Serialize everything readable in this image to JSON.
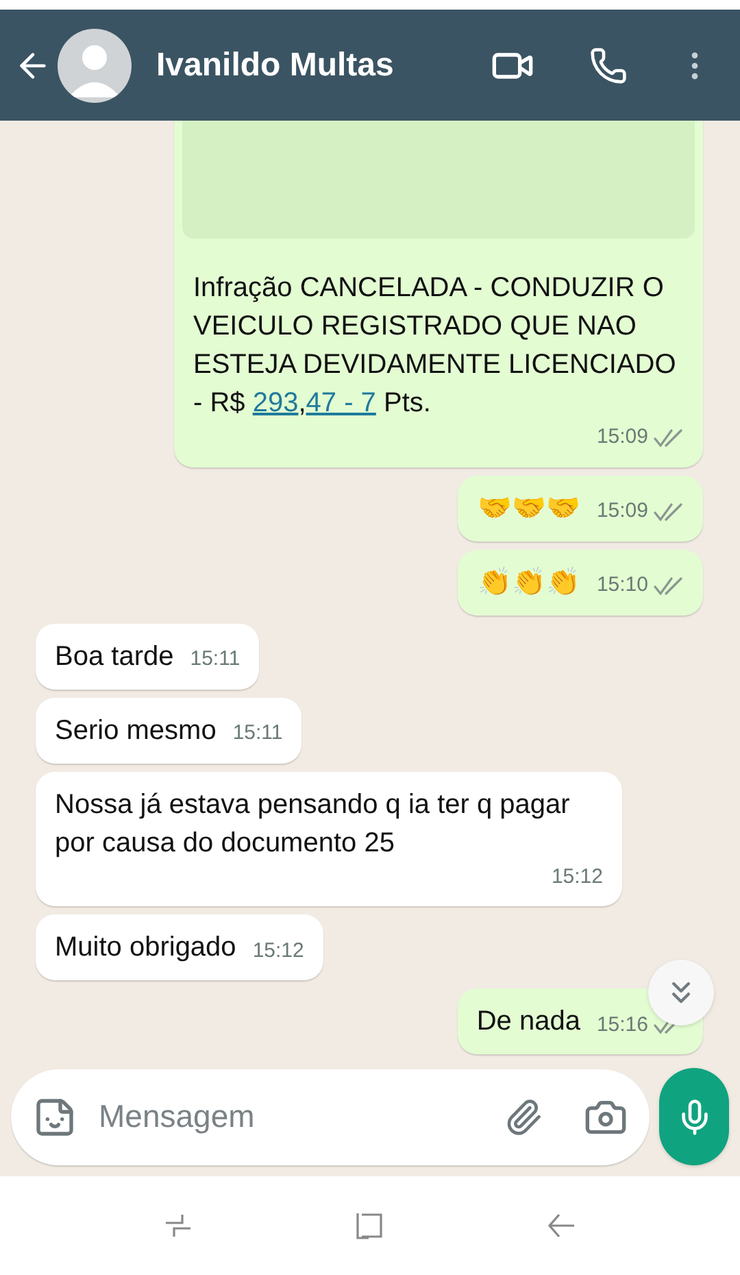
{
  "header": {
    "contact_name": "Ivanildo Multas"
  },
  "messages": [
    {
      "outgoing": true,
      "has_preview": true,
      "parts": [
        {
          "text": "Infração CANCELADA - CONDUZIR O VEICULO REGISTRADO QUE NAO ESTEJA DEVIDAMENTE LICENCIADO - R$ ",
          "link": false
        },
        {
          "text": "293",
          "link": true
        },
        {
          "text": ",",
          "link": false
        },
        {
          "text": "47 - 7",
          "link": true
        },
        {
          "text": " Pts.",
          "link": false
        }
      ],
      "time": "15:09",
      "read": false
    },
    {
      "outgoing": true,
      "has_preview": false,
      "parts": [
        {
          "text": "🤝🤝🤝",
          "link": false
        }
      ],
      "time": "15:09",
      "read": false
    },
    {
      "outgoing": true,
      "has_preview": false,
      "parts": [
        {
          "text": "👏👏👏",
          "link": false
        }
      ],
      "time": "15:10",
      "read": false
    },
    {
      "outgoing": false,
      "has_preview": false,
      "parts": [
        {
          "text": "Boa tarde",
          "link": false
        }
      ],
      "time": "15:11"
    },
    {
      "outgoing": false,
      "has_preview": false,
      "parts": [
        {
          "text": "Serio mesmo",
          "link": false
        }
      ],
      "time": "15:11"
    },
    {
      "outgoing": false,
      "has_preview": false,
      "parts": [
        {
          "text": "Nossa já estava pensando q ia ter q pagar por causa do documento 25",
          "link": false
        }
      ],
      "time": "15:12"
    },
    {
      "outgoing": false,
      "has_preview": false,
      "parts": [
        {
          "text": "Muito obrigado",
          "link": false
        }
      ],
      "time": "15:12"
    },
    {
      "outgoing": true,
      "has_preview": false,
      "parts": [
        {
          "text": "De nada",
          "link": false
        }
      ],
      "time": "15:16",
      "read": false
    }
  ],
  "composer": {
    "placeholder": "Mensagem"
  }
}
